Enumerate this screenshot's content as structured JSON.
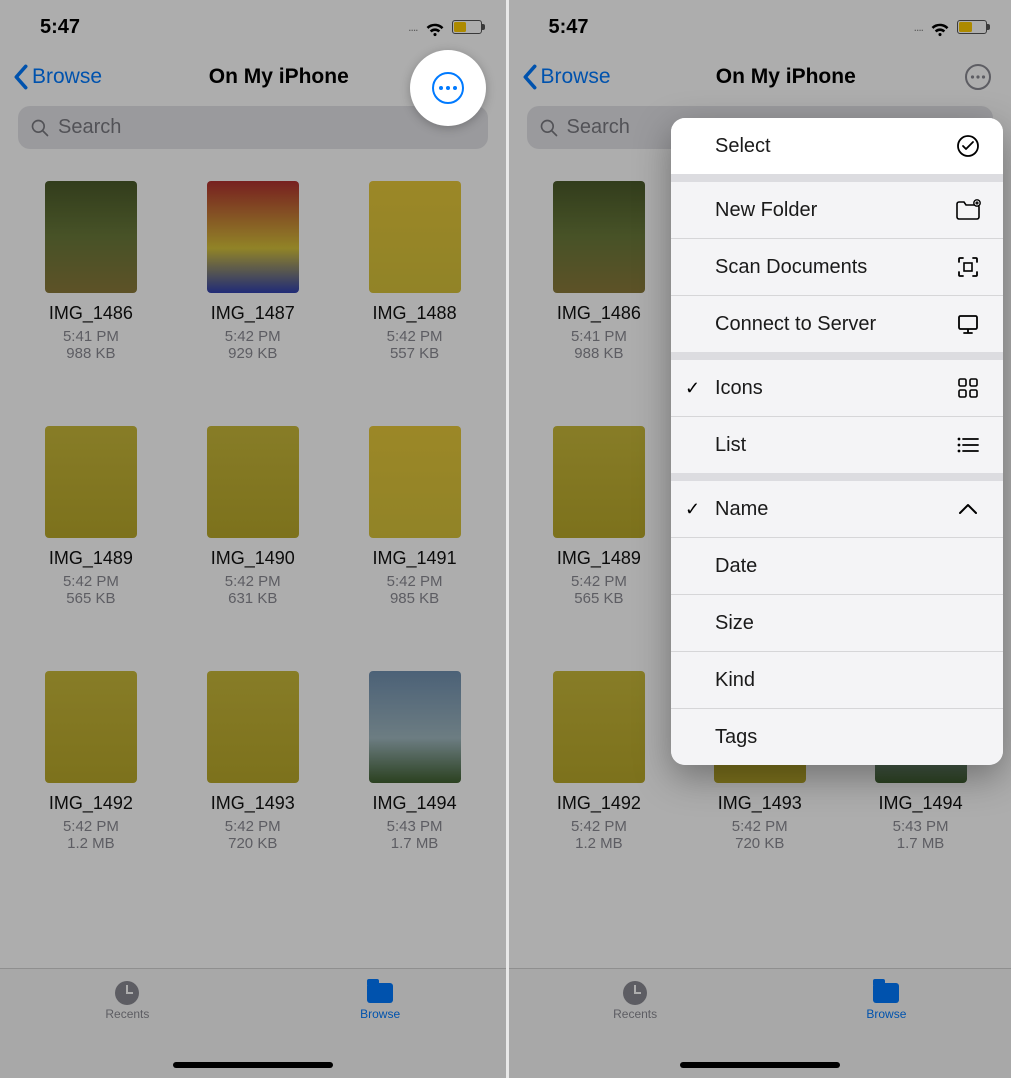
{
  "status": {
    "time": "5:47"
  },
  "colors": {
    "accent": "#007aff",
    "battery_fill": "#ffcc00"
  },
  "nav": {
    "back": "Browse",
    "title": "On My iPhone"
  },
  "search": {
    "placeholder": "Search"
  },
  "files": [
    {
      "name": "IMG_1486",
      "time": "5:41 PM",
      "size": "988 KB",
      "thumb": "a"
    },
    {
      "name": "IMG_1487",
      "time": "5:42 PM",
      "size": "929 KB",
      "thumb": "b"
    },
    {
      "name": "IMG_1488",
      "time": "5:42 PM",
      "size": "557 KB",
      "thumb": "c"
    },
    {
      "name": "IMG_1489",
      "time": "5:42 PM",
      "size": "565 KB",
      "thumb": "d"
    },
    {
      "name": "IMG_1490",
      "time": "5:42 PM",
      "size": "631 KB",
      "thumb": "d"
    },
    {
      "name": "IMG_1491",
      "time": "5:42 PM",
      "size": "985 KB",
      "thumb": "c"
    },
    {
      "name": "IMG_1492",
      "time": "5:42 PM",
      "size": "1.2 MB",
      "thumb": "d"
    },
    {
      "name": "IMG_1493",
      "time": "5:42 PM",
      "size": "720 KB",
      "thumb": "d"
    },
    {
      "name": "IMG_1494",
      "time": "5:43 PM",
      "size": "1.7 MB",
      "thumb": "e"
    }
  ],
  "tabs": {
    "recents": "Recents",
    "browse": "Browse"
  },
  "menu": {
    "select": "Select",
    "new_folder": "New Folder",
    "scan_documents": "Scan Documents",
    "connect_to_server": "Connect to Server",
    "icons": "Icons",
    "list": "List",
    "name": "Name",
    "date": "Date",
    "size": "Size",
    "kind": "Kind",
    "tags": "Tags",
    "view_selected": "Icons",
    "sort_selected": "Name"
  }
}
